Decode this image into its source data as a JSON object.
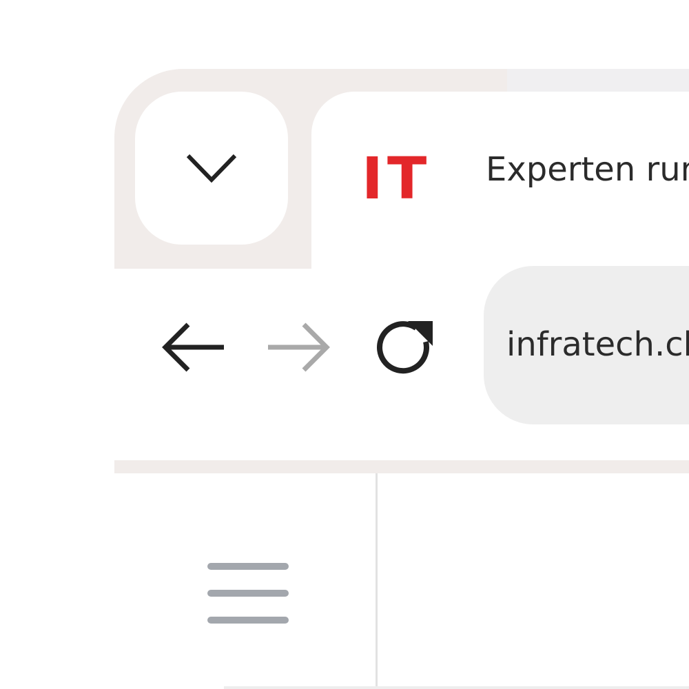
{
  "tab": {
    "favicon_text": "IT",
    "title": "Experten run"
  },
  "toolbar": {
    "url": "infratech.ch"
  },
  "icons": {
    "tab_search": "chevron-down-icon",
    "back": "arrow-left-icon",
    "forward": "arrow-right-icon",
    "reload": "reload-icon",
    "menu": "hamburger-menu-icon"
  },
  "colors": {
    "brand_red": "#e3272a",
    "tab_strip": "#f1ecea",
    "omnibox": "#eeeeee",
    "icon_active": "#222222",
    "icon_disabled": "#a9a9a9",
    "menu_icon": "#a3a7ad"
  }
}
